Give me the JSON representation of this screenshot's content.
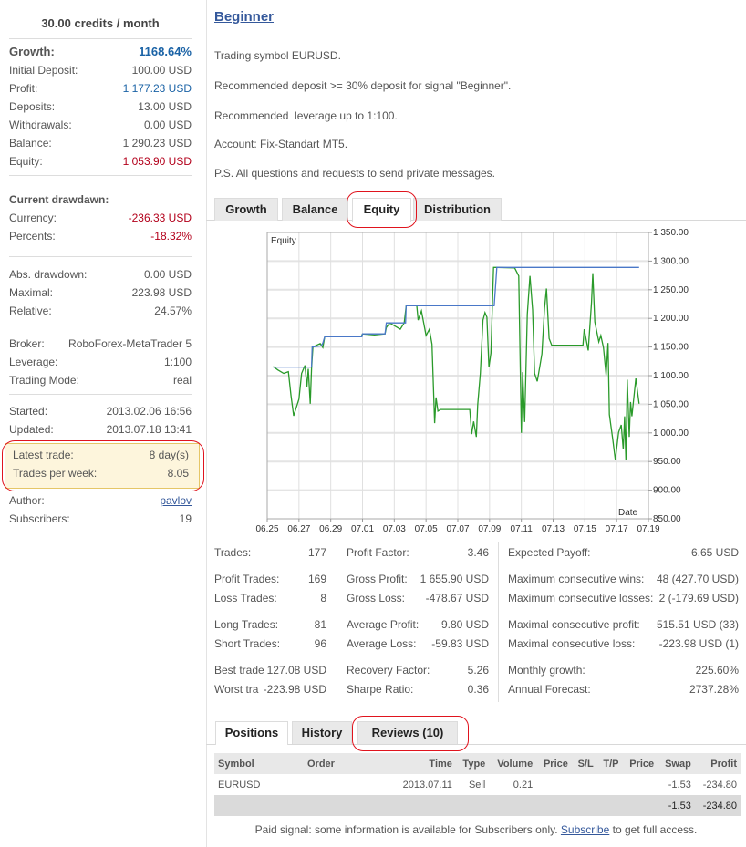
{
  "sidebar": {
    "price": "30.00 credits / month",
    "growth": {
      "label": "Growth:",
      "value": "1168.64%"
    },
    "initial_deposit": {
      "label": "Initial Deposit:",
      "value": "100.00 USD"
    },
    "profit": {
      "label": "Profit:",
      "value": "1 177.23 USD"
    },
    "deposits": {
      "label": "Deposits:",
      "value": "13.00 USD"
    },
    "withdrawals": {
      "label": "Withdrawals:",
      "value": "0.00 USD"
    },
    "balance": {
      "label": "Balance:",
      "value": "1 290.23 USD"
    },
    "equity": {
      "label": "Equity:",
      "value": "1 053.90 USD"
    },
    "current_drawdown_heading": "Current drawdawn:",
    "currency": {
      "label": "Currency:",
      "value": "-236.33 USD"
    },
    "percents": {
      "label": "Percents:",
      "value": "-18.32%"
    },
    "abs_drawdown": {
      "label": "Abs. drawdown:",
      "value": "0.00 USD"
    },
    "maximal": {
      "label": "Maximal:",
      "value": "223.98 USD"
    },
    "relative": {
      "label": "Relative:",
      "value": "24.57%"
    },
    "broker": {
      "label": "Broker:",
      "value": "RoboForex-MetaTrader 5"
    },
    "leverage": {
      "label": "Leverage:",
      "value": "1:100"
    },
    "trading_mode": {
      "label": "Trading Mode:",
      "value": "real"
    },
    "started": {
      "label": "Started:",
      "value": "2013.02.06 16:56"
    },
    "updated": {
      "label": "Updated:",
      "value": "2013.07.18 13:41"
    },
    "latest_trade": {
      "label": "Latest trade:",
      "value": "8 day(s)"
    },
    "trades_per_week": {
      "label": "Trades per week:",
      "value": "8.05"
    },
    "author": {
      "label": "Author:",
      "value": "pavlov"
    },
    "subscribers": {
      "label": "Subscribers:",
      "value": "19"
    }
  },
  "main": {
    "title": "Beginner",
    "description": [
      "Trading symbol EURUSD.",
      "Recommended deposit >= 30% deposit for signal \"Beginner\".",
      "Recommended  leverage up to 1:100.",
      "Account: Fix-Standart MT5.",
      "P.S. All questions and requests to send private messages."
    ],
    "chart_tabs": [
      "Growth",
      "Balance",
      "Equity",
      "Distribution"
    ],
    "active_chart_tab": "Equity",
    "stats": {
      "col1": [
        {
          "label": "Trades:",
          "value": "177"
        },
        {
          "label": "Profit Trades:",
          "value": "169"
        },
        {
          "label": "Loss Trades:",
          "value": "8"
        },
        {
          "label": "Long Trades:",
          "value": "81"
        },
        {
          "label": "Short Trades:",
          "value": "96"
        },
        {
          "label": "Best trade",
          "value": "127.08 USD"
        },
        {
          "label": "Worst tra",
          "value": "-223.98 USD"
        }
      ],
      "col2": [
        {
          "label": "Profit Factor:",
          "value": "3.46"
        },
        {
          "label": "Gross Profit:",
          "value": "1 655.90 USD"
        },
        {
          "label": "Gross Loss:",
          "value": "-478.67 USD"
        },
        {
          "label": "Average Profit:",
          "value": "9.80 USD"
        },
        {
          "label": "Average Loss:",
          "value": "-59.83 USD"
        },
        {
          "label": "Recovery Factor:",
          "value": "5.26"
        },
        {
          "label": "Sharpe Ratio:",
          "value": "0.36"
        }
      ],
      "col3": [
        {
          "label": "Expected Payoff:",
          "value": "6.65 USD"
        },
        {
          "label": "Maximum consecutive wins:",
          "value": "48 (427.70 USD)"
        },
        {
          "label": "Maximum consecutive losses:",
          "value": "2 (-179.69 USD)"
        },
        {
          "label": "Maximal consecutive profit:",
          "value": "515.51 USD (33)"
        },
        {
          "label": "Maximal consecutive loss:",
          "value": "-223.98 USD (1)"
        },
        {
          "label": "Monthly growth:",
          "value": "225.60%"
        },
        {
          "label": "Annual Forecast:",
          "value": "2737.28%"
        }
      ]
    },
    "bottom_tabs": [
      "Positions",
      "History",
      "Reviews (10)"
    ],
    "active_bottom_tab": "Positions",
    "positions": {
      "headers": [
        "Symbol",
        "Order",
        "Time",
        "Type",
        "Volume",
        "Price",
        "S/L",
        "T/P",
        "Price",
        "Swap",
        "Profit"
      ],
      "rows": [
        [
          "EURUSD",
          "",
          "2013.07.11",
          "Sell",
          "0.21",
          "",
          "",
          "",
          "",
          "-1.53",
          "-234.80"
        ]
      ],
      "total": {
        "swap": "-1.53",
        "profit": "-234.80"
      }
    },
    "footer": {
      "before": "Paid signal: some information is available for Subscribers only. ",
      "link": "Subscribe",
      "after": " to get full access."
    }
  },
  "colors": {
    "accent_blue": "#1b63a6",
    "negative_red": "#b3001b",
    "equity_line": "#2a9a2a",
    "balance_line": "#4a78c8",
    "annotation_red": "#e0141e"
  },
  "chart_data": {
    "type": "line",
    "legend_label": "Equity",
    "xlabel": "Date",
    "x_ticks": [
      "06.25",
      "06.27",
      "06.29",
      "07.01",
      "07.03",
      "07.05",
      "07.07",
      "07.09",
      "07.11",
      "07.13",
      "07.15",
      "07.17",
      "07.19"
    ],
    "y_ticks": [
      "850.00",
      "900.00",
      "950.00",
      "1 000.00",
      "1 050.00",
      "1 100.00",
      "1 150.00",
      "1 200.00",
      "1 250.00",
      "1 300.00",
      "1 350.00"
    ],
    "ylim": [
      850,
      1350
    ],
    "xlim": [
      "06.25 00:00",
      "07.19 00:00"
    ],
    "grid": true,
    "series": [
      {
        "id": "equity",
        "color": "#2a9a2a",
        "points": [
          [
            "06.25 09:00",
            1116
          ],
          [
            "06.25 16:00",
            1110
          ],
          [
            "06.26 01:00",
            1104
          ],
          [
            "06.26 08:00",
            1107
          ],
          [
            "06.26 12:00",
            1065
          ],
          [
            "06.26 16:00",
            1030
          ],
          [
            "06.26 19:00",
            1041
          ],
          [
            "06.27 00:00",
            1059
          ],
          [
            "06.27 04:00",
            1104
          ],
          [
            "06.27 09:00",
            1118
          ],
          [
            "06.27 12:00",
            1080
          ],
          [
            "06.27 14:00",
            1112
          ],
          [
            "06.27 17:00",
            1051
          ],
          [
            "06.27 19:00",
            1112
          ],
          [
            "06.27 21:00",
            1150
          ],
          [
            "06.28 08:00",
            1156
          ],
          [
            "06.28 12:00",
            1149
          ],
          [
            "06.28 15:00",
            1168
          ],
          [
            "06.30 22:00",
            1168
          ],
          [
            "07.01 00:00",
            1173
          ],
          [
            "07.01 18:00",
            1171
          ],
          [
            "07.02 10:00",
            1173
          ],
          [
            "07.02 12:00",
            1184
          ],
          [
            "07.02 17:00",
            1192
          ],
          [
            "07.03 09:00",
            1181
          ],
          [
            "07.03 15:00",
            1192
          ],
          [
            "07.03 18:00",
            1222
          ],
          [
            "07.04 10:00",
            1222
          ],
          [
            "07.04 12:00",
            1197
          ],
          [
            "07.04 17:00",
            1213
          ],
          [
            "07.05 00:00",
            1170
          ],
          [
            "07.05 05:00",
            1181
          ],
          [
            "07.05 09:00",
            1155
          ],
          [
            "07.05 13:00",
            1017
          ],
          [
            "07.05 15:00",
            1062
          ],
          [
            "07.05 18:00",
            1038
          ],
          [
            "07.05 22:00",
            1041
          ],
          [
            "07.07 18:00",
            1041
          ],
          [
            "07.07 21:00",
            998
          ],
          [
            "07.08 00:00",
            1020
          ],
          [
            "07.08 04:00",
            993
          ],
          [
            "07.08 06:00",
            1049
          ],
          [
            "07.08 10:00",
            1104
          ],
          [
            "07.08 14:00",
            1197
          ],
          [
            "07.08 17:00",
            1210
          ],
          [
            "07.08 20:00",
            1202
          ],
          [
            "07.08 23:00",
            1115
          ],
          [
            "07.09 02:00",
            1139
          ],
          [
            "07.09 06:00",
            1289
          ],
          [
            "07.09 11:00",
            1289
          ],
          [
            "07.10 14:00",
            1288
          ],
          [
            "07.10 20:00",
            1274
          ],
          [
            "07.11 00:00",
            1000
          ],
          [
            "07.11 02:00",
            1106
          ],
          [
            "07.11 05:00",
            1019
          ],
          [
            "07.11 09:00",
            1207
          ],
          [
            "07.11 13:00",
            1274
          ],
          [
            "07.11 17:00",
            1215
          ],
          [
            "07.11 20:00",
            1104
          ],
          [
            "07.12 00:00",
            1090
          ],
          [
            "07.12 04:00",
            1117
          ],
          [
            "07.12 07:00",
            1138
          ],
          [
            "07.12 11:00",
            1218
          ],
          [
            "07.12 14:00",
            1252
          ],
          [
            "07.12 18:00",
            1165
          ],
          [
            "07.12 22:00",
            1153
          ],
          [
            "07.14 21:00",
            1153
          ],
          [
            "07.14 23:00",
            1181
          ],
          [
            "07.15 05:00",
            1144
          ],
          [
            "07.15 10:00",
            1228
          ],
          [
            "07.15 12:00",
            1279
          ],
          [
            "07.15 15:00",
            1194
          ],
          [
            "07.15 21:00",
            1159
          ],
          [
            "07.16 00:00",
            1170
          ],
          [
            "07.16 04:00",
            1149
          ],
          [
            "07.16 08:00",
            1101
          ],
          [
            "07.16 11:00",
            1157
          ],
          [
            "07.16 13:00",
            1032
          ],
          [
            "07.16 18:00",
            990
          ],
          [
            "07.16 22:00",
            953
          ],
          [
            "07.17 03:00",
            1001
          ],
          [
            "07.17 07:00",
            1014
          ],
          [
            "07.17 10:00",
            971
          ],
          [
            "07.17 12:00",
            1029
          ],
          [
            "07.17 14:00",
            953
          ],
          [
            "07.17 16:00",
            1093
          ],
          [
            "07.17 19:00",
            993
          ],
          [
            "07.17 21:00",
            1054
          ],
          [
            "07.17 23:00",
            1029
          ],
          [
            "07.18 05:00",
            1095
          ],
          [
            "07.18 10:00",
            1051
          ]
        ]
      },
      {
        "id": "balance",
        "color": "#4a78c8",
        "points": [
          [
            "06.25 09:00",
            1115
          ],
          [
            "06.27 19:00",
            1115
          ],
          [
            "06.27 20:00",
            1150
          ],
          [
            "06.28 10:00",
            1152
          ],
          [
            "06.28 12:00",
            1157
          ],
          [
            "06.28 15:00",
            1168
          ],
          [
            "06.30 23:00",
            1168
          ],
          [
            "07.01 00:00",
            1173
          ],
          [
            "07.02 10:00",
            1173
          ],
          [
            "07.02 12:00",
            1192
          ],
          [
            "07.03 17:00",
            1192
          ],
          [
            "07.03 18:00",
            1222
          ],
          [
            "07.09 07:00",
            1222
          ],
          [
            "07.09 11:00",
            1289
          ],
          [
            "07.18 10:00",
            1289
          ]
        ]
      }
    ]
  }
}
